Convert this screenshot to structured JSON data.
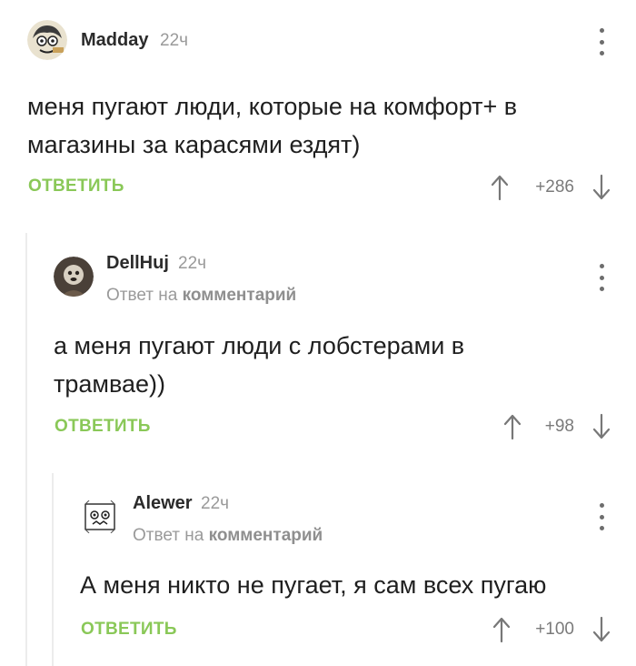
{
  "comments": [
    {
      "author": "Madday",
      "time": "22ч",
      "text": "меня пугают люди, которые на комфорт+ в магазины за карасями ездят)",
      "reply_label": "ОТВЕТИТЬ",
      "score": "+286"
    },
    {
      "author": "DellHuj",
      "time": "22ч",
      "reply_to_prefix": "Ответ на",
      "reply_to_link": "комментарий",
      "text": "а меня пугают люди с лобстерами в трамвае))",
      "reply_label": "ОТВЕТИТЬ",
      "score": "+98"
    },
    {
      "author": "Alewer",
      "time": "22ч",
      "reply_to_prefix": "Ответ на",
      "reply_to_link": "комментарий",
      "text": "А меня никто не пугает, я сам всех пугаю",
      "reply_label": "ОТВЕТИТЬ",
      "score": "+100"
    }
  ],
  "icons": {
    "menu": "kebab-menu-icon",
    "upvote": "arrow-up-icon",
    "downvote": "arrow-down-icon"
  },
  "colors": {
    "reply_green": "#8ac858",
    "muted": "#9a9a9a",
    "thread_line": "#ececec"
  }
}
